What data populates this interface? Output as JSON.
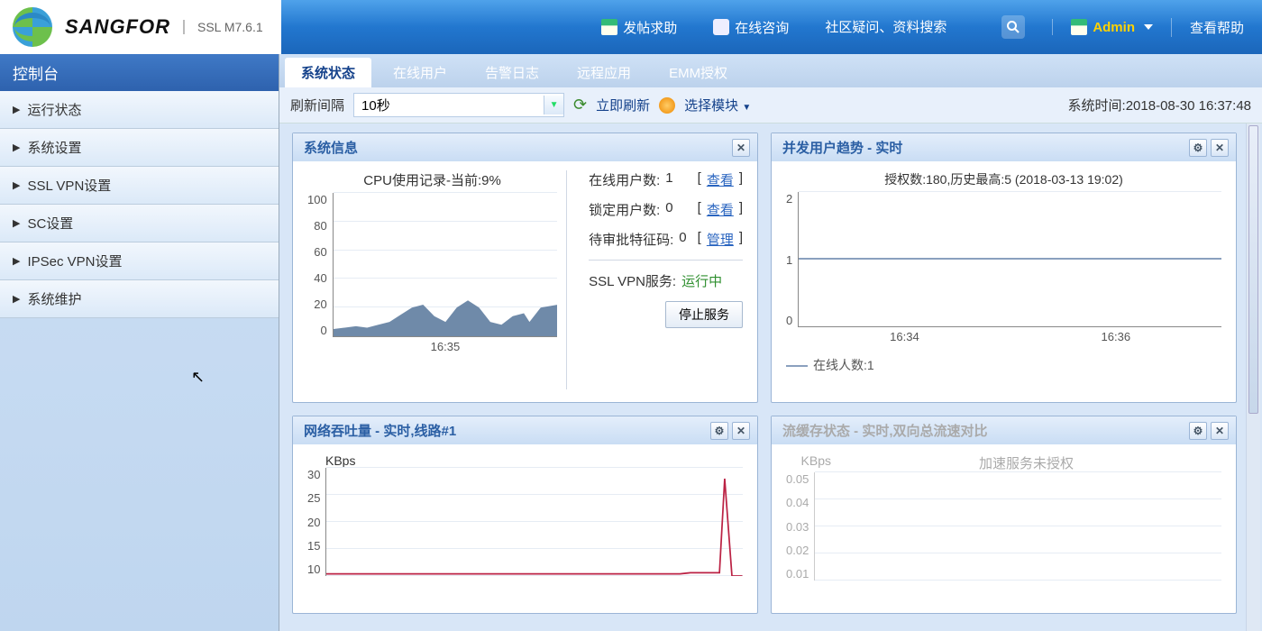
{
  "header": {
    "brand": "SANGFOR",
    "version": "SSL M7.6.1",
    "post_help": "发帖求助",
    "online_consult": "在线咨询",
    "search_placeholder": "社区疑问、资料搜索",
    "admin_name": "Admin",
    "help": "查看帮助"
  },
  "sidebar": {
    "title": "控制台",
    "items": [
      {
        "label": "运行状态"
      },
      {
        "label": "系统设置"
      },
      {
        "label": "SSL VPN设置"
      },
      {
        "label": "SC设置"
      },
      {
        "label": "IPSec VPN设置"
      },
      {
        "label": "系统维护"
      }
    ]
  },
  "tabs": [
    {
      "label": "系统状态",
      "active": true
    },
    {
      "label": "在线用户"
    },
    {
      "label": "告警日志"
    },
    {
      "label": "远程应用"
    },
    {
      "label": "EMM授权"
    }
  ],
  "toolbar": {
    "refresh_label": "刷新间隔",
    "interval_value": "10秒",
    "refresh_now": "立即刷新",
    "select_mod": "选择模块",
    "sys_time": "系统时间:2018-08-30 16:37:48"
  },
  "panels": {
    "sysinfo": {
      "title": "系统信息",
      "cpu_title": "CPU使用记录-当前:9%",
      "online_users_label": "在线用户数:",
      "online_users_val": "1",
      "locked_users_label": "锁定用户数:",
      "locked_users_val": "0",
      "pending_label": "待审批特征码:",
      "pending_val": "0",
      "view": "查看",
      "manage": "管理",
      "service_label": "SSL VPN服务:",
      "service_status": "运行中",
      "stop_btn": "停止服务",
      "x_tick": "16:35"
    },
    "users_trend": {
      "title": "并发用户趋势 - 实时",
      "sub": "授权数:180,历史最高:5 (2018-03-13 19:02)",
      "legend": "在线人数:1",
      "x_ticks": [
        "16:34",
        "16:36"
      ]
    },
    "throughput": {
      "title": "网络吞吐量 - 实时,线路#1",
      "unit": "KBps"
    },
    "cache": {
      "title": "流缓存状态 - 实时,双向总流速对比",
      "unit": "KBps",
      "notice": "加速服务未授权"
    }
  },
  "chart_data": [
    {
      "type": "area",
      "title": "CPU使用记录-当前:9%",
      "x": [
        0,
        1,
        2,
        3,
        4,
        5,
        6,
        7,
        8,
        9,
        10,
        11,
        12,
        13,
        14,
        15,
        16,
        17,
        18,
        19,
        20,
        21,
        22,
        23,
        24,
        25,
        26,
        27,
        28,
        29
      ],
      "values": [
        5,
        6,
        7,
        6,
        7,
        8,
        9,
        12,
        18,
        22,
        20,
        14,
        10,
        8,
        20,
        25,
        22,
        16,
        10,
        7,
        6,
        8,
        14,
        16,
        12,
        8,
        6,
        10,
        18,
        22
      ],
      "ylim": [
        0,
        100
      ],
      "yticks": [
        0,
        20,
        40,
        60,
        80,
        100
      ],
      "xlabel_ticks": [
        "16:35"
      ]
    },
    {
      "type": "line",
      "title": "并发用户趋势 - 实时",
      "series": [
        {
          "name": "在线人数",
          "values": [
            1,
            1,
            1,
            1,
            1,
            1,
            1,
            1,
            1,
            1
          ]
        }
      ],
      "x": [
        0,
        1,
        2,
        3,
        4,
        5,
        6,
        7,
        8,
        9
      ],
      "ylim": [
        0,
        2
      ],
      "yticks": [
        0,
        1,
        2
      ],
      "xlabel_ticks": [
        "16:34",
        "16:36"
      ],
      "subtitle": "授权数:180,历史最高:5 (2018-03-13 19:02)"
    },
    {
      "type": "line",
      "title": "网络吞吐量 - 实时,线路#1",
      "x": [
        0,
        1,
        2,
        3,
        4,
        5,
        6,
        7,
        8,
        9,
        10,
        11,
        12,
        13,
        14,
        15,
        16,
        17,
        18,
        19,
        20,
        21,
        22,
        23,
        24,
        25,
        26,
        27
      ],
      "values": [
        1,
        1,
        2,
        1,
        1,
        1,
        2,
        1,
        1,
        1,
        1,
        2,
        1,
        1,
        1,
        1,
        2,
        1,
        1,
        1,
        1,
        1,
        1,
        1,
        1,
        1,
        28,
        0
      ],
      "ylim": [
        0,
        30
      ],
      "yticks": [
        10,
        15,
        20,
        25,
        30
      ],
      "unit": "KBps"
    },
    {
      "type": "line",
      "title": "流缓存状态 - 实时,双向总流速对比",
      "x": [
        0,
        1,
        2,
        3,
        4,
        5,
        6,
        7,
        8,
        9
      ],
      "values": [
        0,
        0,
        0,
        0,
        0,
        0,
        0,
        0,
        0,
        0
      ],
      "ylim": [
        0,
        0.05
      ],
      "yticks": [
        0.01,
        0.02,
        0.03,
        0.04,
        0.05
      ],
      "unit": "KBps",
      "notice": "加速服务未授权"
    }
  ]
}
